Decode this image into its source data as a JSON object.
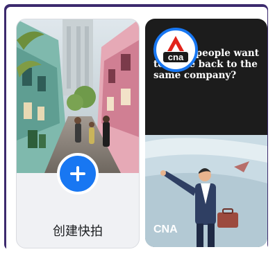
{
  "create_card": {
    "label": "创建快拍",
    "add_icon": "plus-icon",
    "accent": "#1877f2"
  },
  "story_card": {
    "headline": "Why do people want to come back to the same company?",
    "author": "CNA",
    "avatar_logo": "cna"
  }
}
